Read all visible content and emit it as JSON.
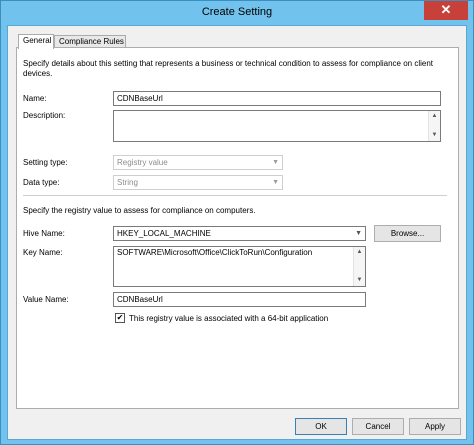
{
  "window": {
    "title": "Create Setting",
    "close_glyph": "✕"
  },
  "tabs": [
    {
      "label": "General",
      "active": true
    },
    {
      "label": "Compliance Rules",
      "active": false
    }
  ],
  "general": {
    "intro": "Specify details about this setting that represents a business or technical condition to assess for compliance on client devices.",
    "name_label": "Name:",
    "name_value": "CDNBaseUrl",
    "description_label": "Description:",
    "description_value": "",
    "setting_type_label": "Setting type:",
    "setting_type_value": "Registry value",
    "data_type_label": "Data type:",
    "data_type_value": "String"
  },
  "registry": {
    "intro": "Specify the registry value to assess for compliance on computers.",
    "hive_label": "Hive Name:",
    "hive_value": "HKEY_LOCAL_MACHINE",
    "browse_label": "Browse...",
    "key_label": "Key Name:",
    "key_value": "SOFTWARE\\Microsoft\\Office\\ClickToRun\\Configuration",
    "value_name_label": "Value Name:",
    "value_name_value": "CDNBaseUrl",
    "x64_checkbox_label": "This registry value is associated with a 64-bit application",
    "x64_checked": true
  },
  "footer": {
    "ok_label": "OK",
    "cancel_label": "Cancel",
    "apply_label": "Apply"
  },
  "colors": {
    "titlebar": "#71c2ec",
    "close": "#c7413a"
  }
}
